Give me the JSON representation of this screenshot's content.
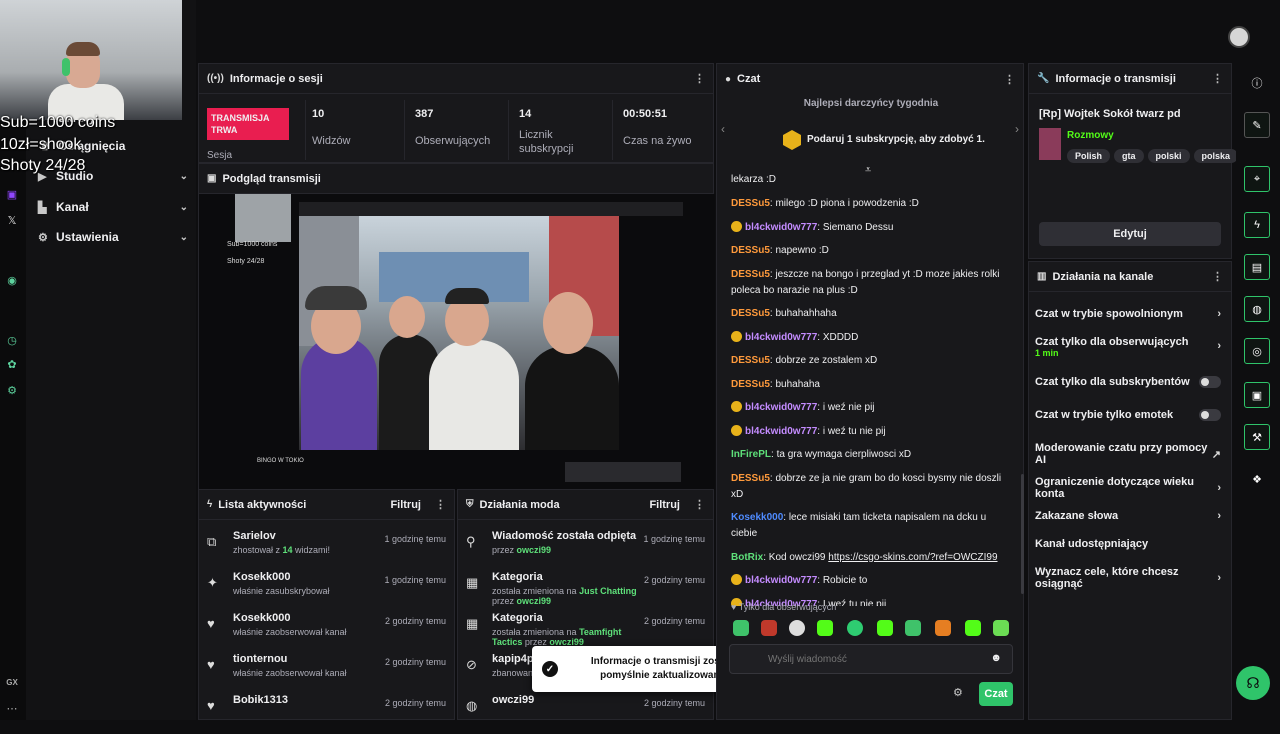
{
  "overlay": {
    "line1": "Sub=1000 coins",
    "line2": "10zł=shook",
    "line3": "Shoty 24/28"
  },
  "leftnav": {
    "items": [
      {
        "label": "Skróty"
      },
      {
        "label": "Osiągnięcia"
      },
      {
        "label": "Studio"
      },
      {
        "label": "Kanał"
      },
      {
        "label": "Ustawienia"
      }
    ]
  },
  "session": {
    "title": "Informacje o sesji",
    "live_badge": "TRANSMISJA TRWA",
    "live_sub": "Sesja",
    "stats": [
      {
        "value": "10",
        "label": "Widzów"
      },
      {
        "value": "387",
        "label": "Obserwujących"
      },
      {
        "value": "14",
        "label": "Licznik subskrypcji"
      },
      {
        "value": "00:50:51",
        "label": "Czas na żywo"
      }
    ]
  },
  "preview": {
    "title": "Podgląd transmisji",
    "video_caption": "BINGO W TOKIO"
  },
  "activity": {
    "title": "Lista aktywności",
    "filter": "Filtruj",
    "items": [
      {
        "user": "Sarielov",
        "text_pre": "zhostował z ",
        "highlight": "14",
        "text_post": " widzami!",
        "time": "1 godzinę temu"
      },
      {
        "user": "Kosekk000",
        "text_pre": "właśnie zasubskrybował",
        "highlight": "",
        "text_post": "",
        "time": "1 godzinę temu"
      },
      {
        "user": "Kosekk000",
        "text_pre": "właśnie zaobserwował kanał",
        "highlight": "",
        "text_post": "",
        "time": "2 godziny temu"
      },
      {
        "user": "tionternou",
        "text_pre": "właśnie zaobserwował kanał",
        "highlight": "",
        "text_post": "",
        "time": "2 godziny temu"
      },
      {
        "user": "Bobik1313",
        "text_pre": "",
        "highlight": "",
        "text_post": "",
        "time": "2 godziny temu"
      }
    ]
  },
  "mod": {
    "title": "Działania moda",
    "filter": "Filtruj",
    "items": [
      {
        "title": "Wiadomość została odpięta",
        "line": "przez ",
        "green1": "owczi99",
        "mid": "",
        "green2": "",
        "time": "1 godzinę temu"
      },
      {
        "title": "Kategoria",
        "line": "została zmieniona na ",
        "green1": "Just Chatting",
        "mid": " przez ",
        "green2": "owczi99",
        "time": "2 godziny temu"
      },
      {
        "title": "Kategoria",
        "line": "została zmieniona na ",
        "green1": "Teamfight Tactics",
        "mid": " przez ",
        "green2": "owczi99",
        "time": "2 godziny temu"
      },
      {
        "title": "kapip4pi",
        "line": "zbanowany",
        "green1": "",
        "mid": "",
        "green2": "",
        "time": ""
      },
      {
        "title": "owczi99",
        "line": "",
        "green1": "",
        "mid": "",
        "green2": "",
        "time": "2 godziny temu"
      }
    ]
  },
  "chat": {
    "title": "Czat",
    "top_gifters": "Najlepsi darczyńcy tygodnia",
    "gift_prompt": "Podaruj 1 subskrypcję, aby zdobyć 1.",
    "messages": [
      {
        "user": "",
        "text": "lekarza :D",
        "color": "#ffffff",
        "badge": false
      },
      {
        "user": "DESSu5",
        "text": ": milego :D piona i powodzenia :D",
        "color": "#ff9a3c",
        "badge": false
      },
      {
        "user": "bl4ckwid0w777",
        "text": ": Siemano Dessu",
        "color": "#c48cff",
        "badge": true
      },
      {
        "user": "DESSu5",
        "text": ": napewno :D",
        "color": "#ff9a3c",
        "badge": false
      },
      {
        "user": "DESSu5",
        "text": ": jeszcze na bongo i przeglad yt :D moze jakies rolki poleca bo narazie na plus :D",
        "color": "#ff9a3c",
        "badge": false
      },
      {
        "user": "DESSu5",
        "text": ": buhahahhaha",
        "color": "#ff9a3c",
        "badge": false
      },
      {
        "user": "bl4ckwid0w777",
        "text": ": XDDDD",
        "color": "#c48cff",
        "badge": true
      },
      {
        "user": "DESSu5",
        "text": ": dobrze ze zostalem xD",
        "color": "#ff9a3c",
        "badge": false
      },
      {
        "user": "DESSu5",
        "text": ": buhahaha",
        "color": "#ff9a3c",
        "badge": false
      },
      {
        "user": "bl4ckwid0w777",
        "text": ": i weź nie pij",
        "color": "#c48cff",
        "badge": true
      },
      {
        "user": "bl4ckwid0w777",
        "text": ": i weź tu nie pij",
        "color": "#c48cff",
        "badge": true
      },
      {
        "user": "InFirePL",
        "text": ": ta gra wymaga cierpliwosci xD",
        "color": "#5ee07a",
        "badge": false
      },
      {
        "user": "DESSu5",
        "text": ": dobrze ze ja nie gram bo do kosci bysmy nie doszli xD",
        "color": "#ff9a3c",
        "badge": false
      },
      {
        "user": "Kosekk000",
        "text": ": lece misiaki tam ticketa napisalem na dcku u ciebie",
        "color": "#4f8bff",
        "badge": false
      },
      {
        "user": "BotRix",
        "text": ": Kod owczi99 ",
        "link": "https://csgo-skins.com/?ref=OWCZI99",
        "color": "#5ee07a",
        "badge": false
      },
      {
        "user": "bl4ckwid0w777",
        "text": ": Robicie to",
        "color": "#c48cff",
        "badge": true
      },
      {
        "user": "bl4ckwid0w777",
        "text": ": I weź tu nie pij",
        "color": "#c48cff",
        "badge": true
      }
    ],
    "followers_only": "Tylko dla obserwujących",
    "input_placeholder": "Wyślij wiadomość",
    "send_label": "Czat"
  },
  "stream_info": {
    "title": "Informacje o transmisji",
    "stream_title": "[Rp] Wojtek Sokół twarz pd",
    "category": "Rozmowy",
    "tags": [
      "Polish",
      "gta",
      "polski",
      "polska"
    ],
    "edit_label": "Edytuj"
  },
  "channel_actions": {
    "title": "Działania na kanale",
    "items": [
      {
        "label": "Czat w trybie spowolnionym",
        "sub": "",
        "control": "chevron"
      },
      {
        "label": "Czat tylko dla obserwujących",
        "sub": "1 min",
        "control": "chevron"
      },
      {
        "label": "Czat tylko dla subskrybentów",
        "sub": "",
        "control": "toggle"
      },
      {
        "label": "Czat w trybie tylko emotek",
        "sub": "",
        "control": "toggle"
      },
      {
        "label": "Moderowanie czatu przy pomocy AI",
        "sub": "",
        "control": "external"
      },
      {
        "label": "Ograniczenie dotyczące wieku konta",
        "sub": "",
        "control": "chevron"
      },
      {
        "label": "Zakazane słowa",
        "sub": "",
        "control": "chevron"
      },
      {
        "label": "Kanał udostępniający",
        "sub": "",
        "control": "none"
      },
      {
        "label": "Wyznacz cele, które chcesz osiągnąć",
        "sub": "",
        "control": "chevron"
      }
    ]
  },
  "toast": {
    "message": "Informacje o transmisji zostały pomyślnie zaktualizowane."
  },
  "rail": {
    "bottom_label": "GX"
  },
  "colors": {
    "live": "#e91e50",
    "accent_green": "#53fc18",
    "send_button": "#2fc46a"
  }
}
